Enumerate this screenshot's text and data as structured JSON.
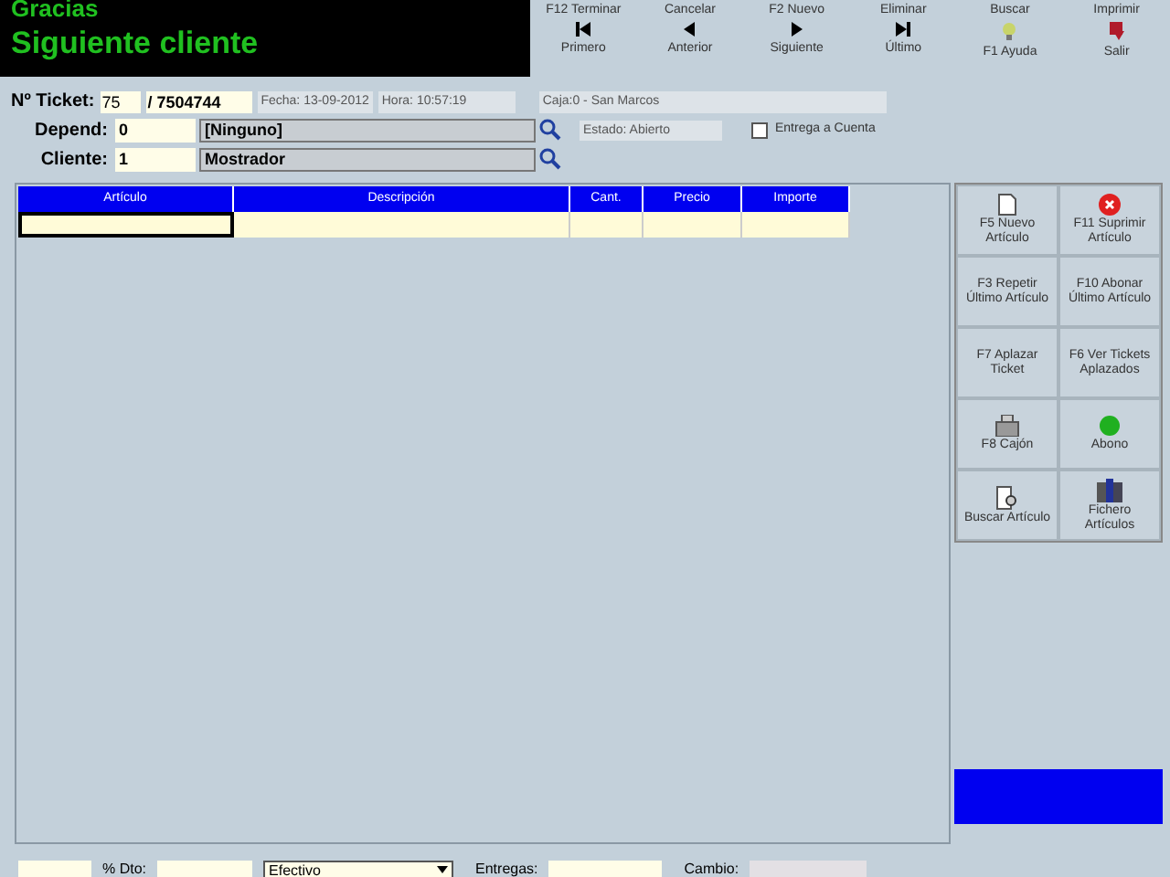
{
  "display": {
    "line_1": "Gracias",
    "line_2": "Siguiente cliente"
  },
  "toolbar": [
    {
      "top": "F12 Terminar",
      "bottom": "Primero",
      "kind": "first"
    },
    {
      "top": "Cancelar",
      "bottom": "Anterior",
      "kind": "prev"
    },
    {
      "top": "F2 Nuevo",
      "bottom": "Siguiente",
      "kind": "next"
    },
    {
      "top": "Eliminar",
      "bottom": "Último",
      "kind": "last"
    },
    {
      "top": "Buscar",
      "bottom": "F1 Ayuda",
      "kind": "help"
    },
    {
      "top": "Imprimir",
      "bottom": "Salir",
      "kind": "exit"
    }
  ],
  "ticket": {
    "label": "Nº Ticket:",
    "number": "75",
    "serial": "/ 7504744",
    "date_label": "Fecha:",
    "date": "13-09-2012",
    "time_label": "Hora:",
    "time": "10:57:19",
    "till": "Caja:0 - San Marcos"
  },
  "depend": {
    "label": "Depend:",
    "code": "0",
    "name": "[Ninguno]"
  },
  "status": {
    "text": "Estado: Abierto"
  },
  "on_account": {
    "label": "Entrega a Cuenta",
    "checked": false
  },
  "client": {
    "label": "Cliente:",
    "code": "1",
    "name": "Mostrador"
  },
  "table": {
    "columns": [
      "Artículo",
      "Descripción",
      "Cant.",
      "Precio",
      "Importe"
    ]
  },
  "side_buttons": [
    {
      "label": "F5 Nuevo Artículo",
      "kind": "page"
    },
    {
      "label": "F11 Suprimir Artículo",
      "kind": "delete"
    },
    {
      "label": "F3 Repetir Último Artículo",
      "kind": "none"
    },
    {
      "label": "F10 Abonar Último Artículo",
      "kind": "none"
    },
    {
      "label": "F7 Aplazar Ticket",
      "kind": "none"
    },
    {
      "label": "F6 Ver Tickets Aplazados",
      "kind": "none"
    },
    {
      "label": "F8 Cajón",
      "kind": "drawer"
    },
    {
      "label": "Abono",
      "kind": "green"
    },
    {
      "label": "Buscar Artículo",
      "kind": "find"
    },
    {
      "label": "Fichero Artículos",
      "kind": "books"
    }
  ],
  "footer": {
    "discount_label": "% Dto:",
    "payment": "Efectivo",
    "given_label": "Entregas:",
    "change_label": "Cambio:"
  }
}
